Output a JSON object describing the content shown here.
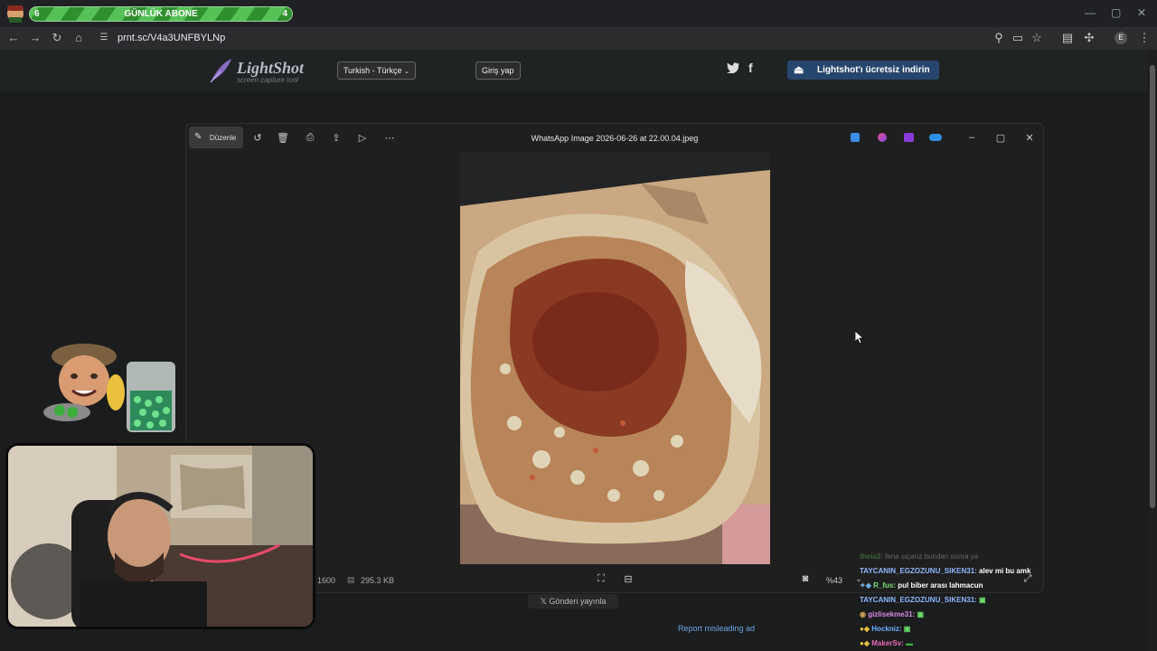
{
  "browser": {
    "url": "prnt.sc/V4a3UNFBYLNp"
  },
  "sub_goal": {
    "label": "GÜNLÜK ABONE",
    "current": "6",
    "target": "4"
  },
  "lightshot": {
    "logo_title": "LightShot",
    "logo_subtitle": "screen capture tool",
    "language": "Turkish - Türkçe",
    "login": "Giriş yap",
    "download": "Lightshot'ı ücretsiz indirin"
  },
  "viewer": {
    "title": "WhatsApp Image 2026-06-26 at 22.00.04.jpeg",
    "edit_label": "Düzenle",
    "size_text": "x 1600",
    "file_size": "295.3 KB",
    "zoom": "%43"
  },
  "page": {
    "share": "Gönderi yayınla",
    "report": "Report misleading ad"
  },
  "chat": [
    {
      "user": "theia3:",
      "message": "fena sıçarız bundan sonra ya",
      "faded": true
    },
    {
      "user": "TAYCANIN_EGZOZUNU_SIKEN31:",
      "message": "alev mi bu amk",
      "faded": false
    },
    {
      "user": "R_fus:",
      "message": "pul biber arası lahmacun",
      "faded": false
    },
    {
      "user": "TAYCANIN_EGZOZUNU_SIKEN31:",
      "message": "",
      "faded": false
    },
    {
      "user": "gizlisekme31:",
      "message": "",
      "faded": false
    },
    {
      "user": "Hockniz:",
      "message": "",
      "faded": false
    },
    {
      "user": "MakerSv:",
      "message": "",
      "faded": false
    }
  ],
  "colors": {
    "accent": "#27466e",
    "link": "#6aa6e6",
    "sub_green": "#56c156"
  }
}
